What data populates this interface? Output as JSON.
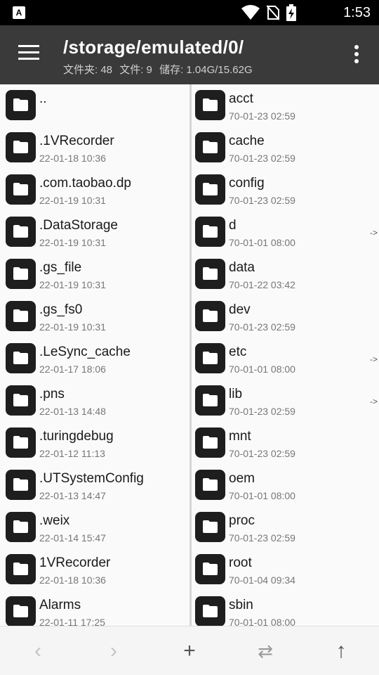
{
  "status_bar": {
    "time": "1:53",
    "app_icon": "A"
  },
  "toolbar": {
    "path": "/storage/emulated/0/",
    "folders_label": "文件夹: 48",
    "files_label": "文件: 9",
    "storage_label": "储存: 1.04G/15.62G"
  },
  "left_pane": [
    {
      "name": "..",
      "date": ""
    },
    {
      "name": ".1VRecorder",
      "date": "22-01-18 10:36"
    },
    {
      "name": ".com.taobao.dp",
      "date": "22-01-19 10:31"
    },
    {
      "name": ".DataStorage",
      "date": "22-01-19 10:31"
    },
    {
      "name": ".gs_file",
      "date": "22-01-19 10:31"
    },
    {
      "name": ".gs_fs0",
      "date": "22-01-19 10:31"
    },
    {
      "name": ".LeSync_cache",
      "date": "22-01-17 18:06"
    },
    {
      "name": ".pns",
      "date": "22-01-13 14:48"
    },
    {
      "name": ".turingdebug",
      "date": "22-01-12 11:13"
    },
    {
      "name": ".UTSystemConfig",
      "date": "22-01-13 14:47"
    },
    {
      "name": ".weix",
      "date": "22-01-14 15:47"
    },
    {
      "name": "1VRecorder",
      "date": "22-01-18 10:36"
    },
    {
      "name": "Alarms",
      "date": "22-01-11 17:25"
    }
  ],
  "right_pane": [
    {
      "name": "acct",
      "date": "70-01-23 02:59",
      "link": ""
    },
    {
      "name": "cache",
      "date": "70-01-23 02:59",
      "link": ""
    },
    {
      "name": "config",
      "date": "70-01-23 02:59",
      "link": ""
    },
    {
      "name": "d",
      "date": "70-01-01 08:00",
      "link": "->"
    },
    {
      "name": "data",
      "date": "70-01-22 03:42",
      "link": ""
    },
    {
      "name": "dev",
      "date": "70-01-23 02:59",
      "link": ""
    },
    {
      "name": "etc",
      "date": "70-01-01 08:00",
      "link": "->"
    },
    {
      "name": "lib",
      "date": "70-01-23 02:59",
      "link": "->"
    },
    {
      "name": "mnt",
      "date": "70-01-23 02:59",
      "link": ""
    },
    {
      "name": "oem",
      "date": "70-01-01 08:00",
      "link": ""
    },
    {
      "name": "proc",
      "date": "70-01-23 02:59",
      "link": ""
    },
    {
      "name": "root",
      "date": "70-01-04 09:34",
      "link": ""
    },
    {
      "name": "sbin",
      "date": "70-01-01 08:00",
      "link": ""
    }
  ],
  "bottom_bar": {
    "back": "‹",
    "forward": "›",
    "add": "+",
    "swap": "⇄",
    "up": "↑"
  },
  "colors": {
    "toolbar": "#3a3a3a",
    "status_bar": "#000000",
    "folder_tile": "#1e1e1e"
  }
}
